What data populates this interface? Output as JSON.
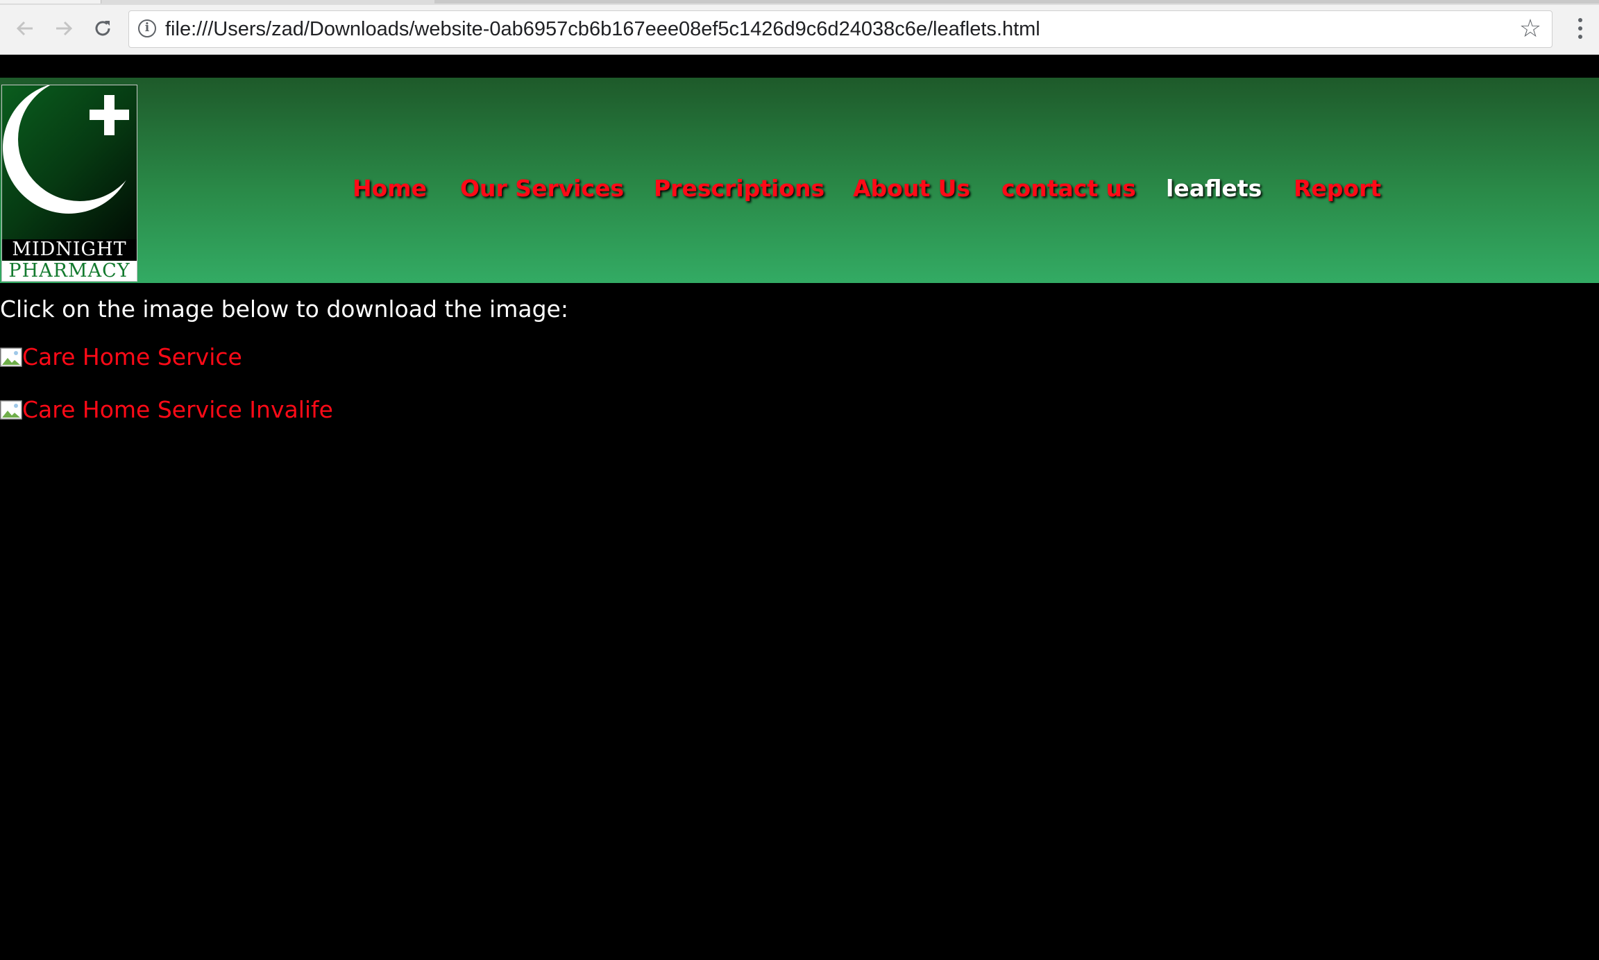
{
  "browser": {
    "url": "file:///Users/zad/Downloads/website-0ab6957cb6b167eee08ef5c1426d9c6d24038c6e/leaflets.html",
    "icons": {
      "back": "back-arrow-icon",
      "forward": "forward-arrow-icon",
      "reload": "reload-icon",
      "info": "info-icon",
      "bookmark": "star-icon",
      "menu": "kebab-menu-icon"
    }
  },
  "site": {
    "logo": {
      "line1": "MIDNIGHT",
      "line2": "PHARMACY"
    },
    "nav": [
      {
        "label": "Home",
        "active": false
      },
      {
        "label": "Our Services",
        "active": false
      },
      {
        "label": "Prescriptions",
        "active": false
      },
      {
        "label": "About Us",
        "active": false
      },
      {
        "label": "contact us",
        "active": false
      },
      {
        "label": "leaflets",
        "active": true
      },
      {
        "label": "Report",
        "active": false
      }
    ],
    "colors": {
      "link": "#ff0a17",
      "active_link": "#ffffff",
      "header_top": "#1e5a2a",
      "header_bottom": "#33ab64",
      "page_bg": "#000000"
    }
  },
  "content": {
    "intro": "Click on the image below to download the image:",
    "downloads": [
      {
        "label": "Care Home Service"
      },
      {
        "label": "Care Home Service Invalife"
      }
    ]
  }
}
